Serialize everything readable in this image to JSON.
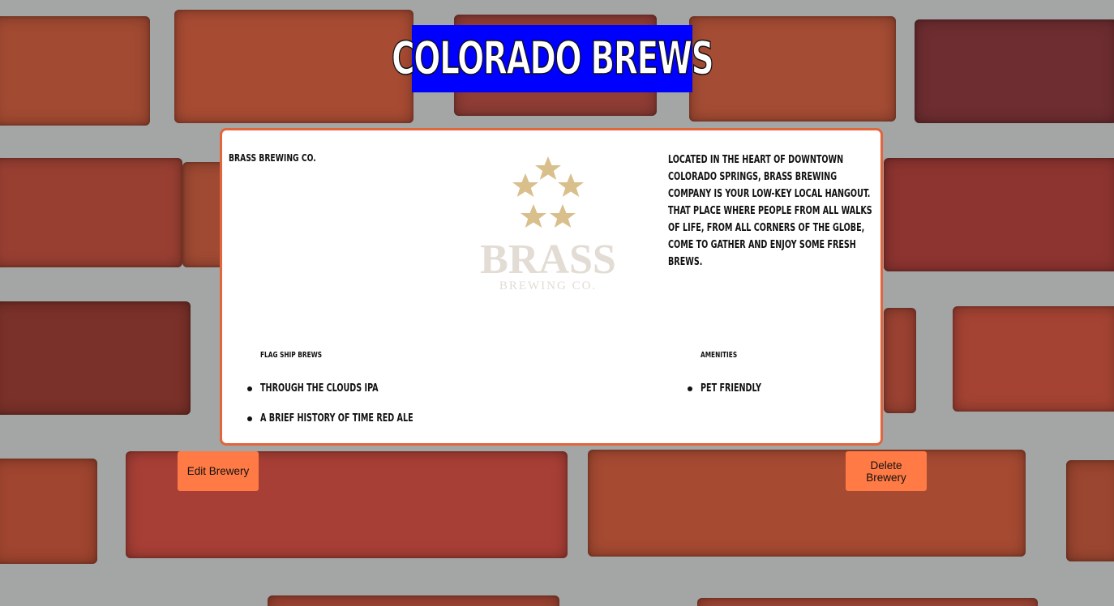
{
  "header": {
    "title": "COLORADO BREWS"
  },
  "brewery": {
    "name": "BRASS BREWING CO.",
    "logo_text": "BRASS",
    "logo_subtext": "BREWING CO.",
    "description": "LOCATED IN THE HEART OF DOWNTOWN COLORADO SPRINGS, BRASS BREWING COMPANY IS YOUR LOW-KEY LOCAL HANGOUT. THAT PLACE WHERE PEOPLE FROM ALL WALKS OF LIFE, FROM ALL CORNERS OF THE GLOBE, COME TO GATHER AND ENJOY SOME FRESH BREWS.",
    "flagship_heading": "FLAG SHIP BREWS",
    "flagship_brews": [
      "THROUGH THE CLOUDS IPA",
      "A BRIEF HISTORY OF TIME RED ALE"
    ],
    "amenities_heading": "AMENITIES",
    "amenities": [
      "PET FRIENDLY"
    ]
  },
  "actions": {
    "edit_label": "Edit Brewery",
    "delete_label": "Delete Brewery"
  },
  "colors": {
    "title_bg": "#0000ff",
    "card_border": "#e2653b",
    "button_bg": "#ff7a45"
  }
}
